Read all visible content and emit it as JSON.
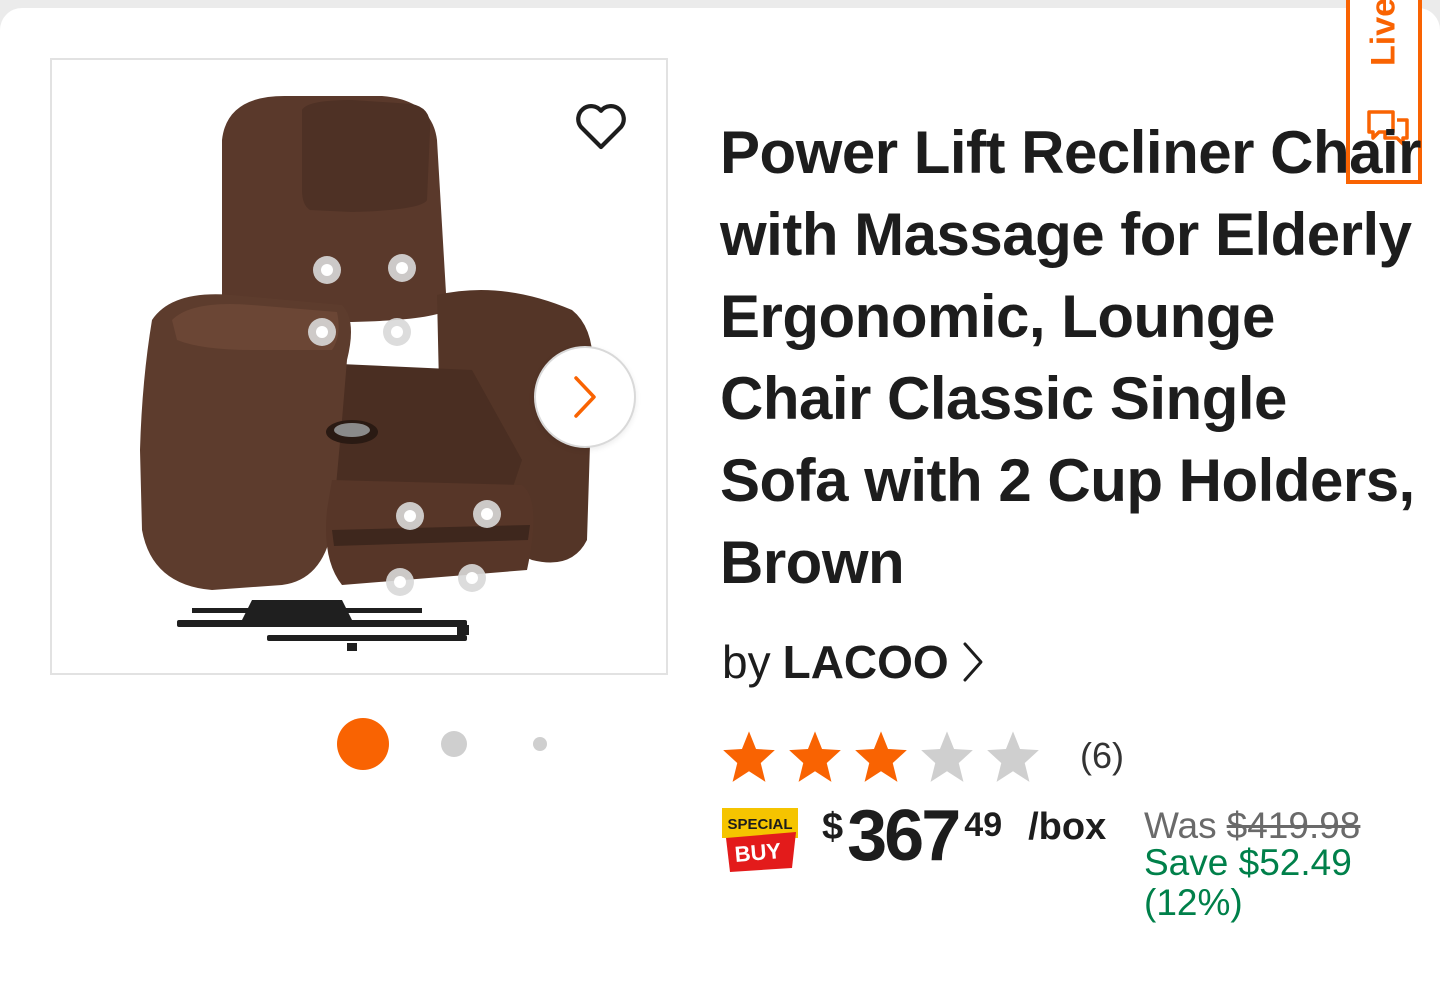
{
  "product": {
    "title": "Power Lift Recliner Chair with Massage for Elderly Ergonomic, Lounge Chair Classic Single Sofa with 2 Cup Holders, Brown",
    "by_label": "by",
    "brand": "LACOO",
    "rating": {
      "stars": 3,
      "max_stars": 5,
      "count_label": "(6)"
    },
    "badge": {
      "line1": "SPECIAL",
      "line2": "BUY"
    },
    "price": {
      "currency": "$",
      "dollars": "367",
      "cents": "49",
      "unit": "/box",
      "was_label": "Was",
      "was_price": "$419.98",
      "save_text": "Save $52.49 (12%)"
    }
  },
  "gallery": {
    "current_index": 1,
    "total_dots": 3
  },
  "live_chat": {
    "label": "Live"
  },
  "colors": {
    "accent": "#f96302",
    "save_green": "#00804a",
    "star_empty": "#cfcfcf",
    "chair_brown": "#5b3a2c"
  },
  "icons": {
    "favorite": "heart-icon",
    "next": "chevron-right-icon",
    "brand_chevron": "chevron-right-icon",
    "chat": "chat-icon",
    "star": "star-icon"
  }
}
